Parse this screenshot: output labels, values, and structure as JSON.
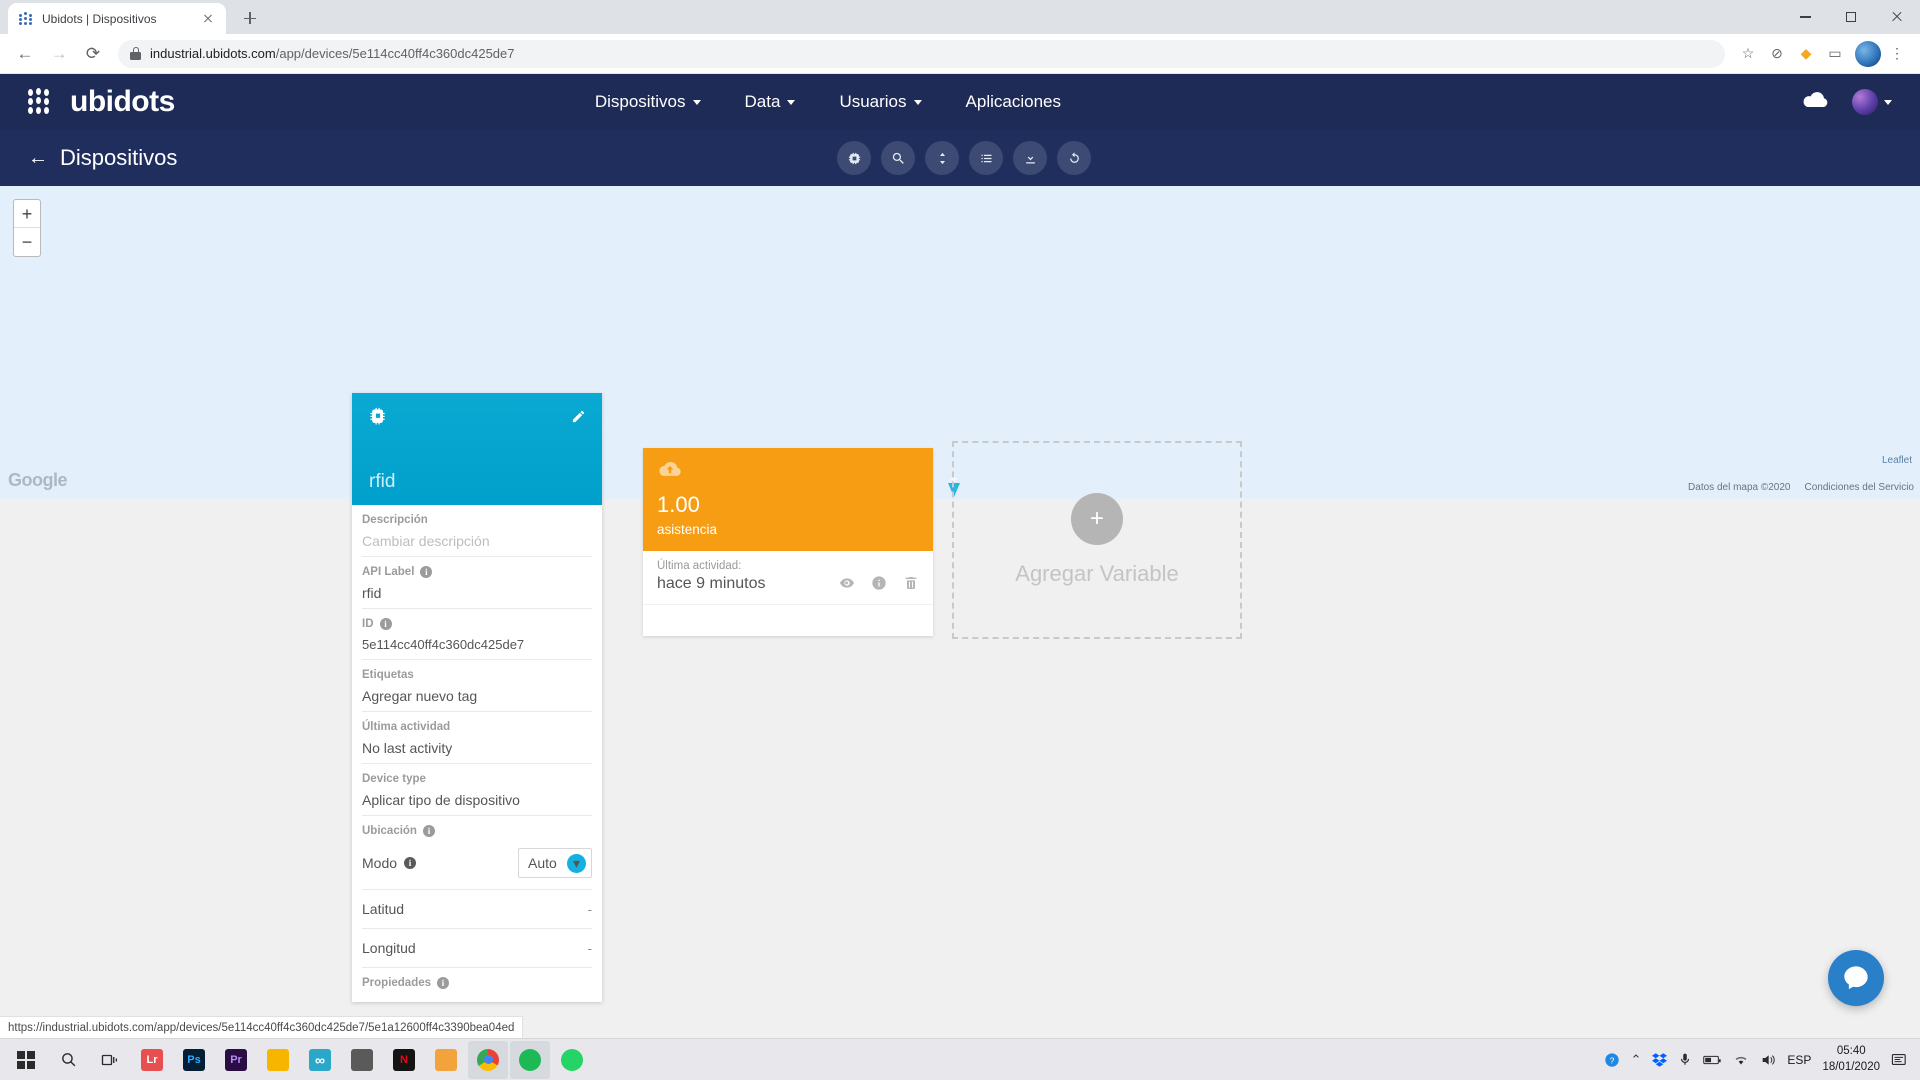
{
  "browser": {
    "tab": {
      "title": "Ubidots | Dispositivos",
      "favicon_icon": "ubidots-dots-icon",
      "close_icon": "close-icon"
    },
    "new_tab_icon": "plus-icon",
    "window_controls": {
      "minimize": "minimize-icon",
      "maximize": "maximize-icon",
      "close": "close-icon"
    },
    "nav": {
      "back_icon": "arrow-left-icon",
      "forward_icon": "arrow-right-icon",
      "reload_icon": "reload-icon"
    },
    "url": {
      "host": "industrial.ubidots.com",
      "path": "/app/devices/5e114cc40ff4c360dc425de7",
      "lock_icon": "lock-icon"
    },
    "omni_icons": [
      "star-icon",
      "block-icon",
      "extension-puzzle-icon",
      "cast-icon",
      "profile-avatar",
      "menu-kebab-icon"
    ],
    "status_link": "https://industrial.ubidots.com/app/devices/5e114cc40ff4c360dc425de7/5e1a12600ff4c3390bea04ed"
  },
  "topnav": {
    "logo_text": "ubidots",
    "logo_icon": "ubidots-dots-icon",
    "items": [
      {
        "label": "Dispositivos",
        "has_caret": true
      },
      {
        "label": "Data",
        "has_caret": true
      },
      {
        "label": "Usuarios",
        "has_caret": true
      },
      {
        "label": "Aplicaciones",
        "has_caret": false
      }
    ],
    "cloud_icon": "cloud-icon",
    "user_menu_icon": "user-avatar"
  },
  "subnav": {
    "back_label": "Dispositivos",
    "back_icon": "arrow-left-icon",
    "toolbar": [
      {
        "name": "device-chip-icon"
      },
      {
        "name": "search-icon"
      },
      {
        "name": "sort-icon"
      },
      {
        "name": "list-icon"
      },
      {
        "name": "download-icon"
      },
      {
        "name": "refresh-icon"
      }
    ]
  },
  "map": {
    "zoom_in": "+",
    "zoom_out": "−",
    "watermark": "Google",
    "pin_icon": "map-pin-plus-icon",
    "leaflet": "Leaflet",
    "attribution": [
      "Datos del mapa ©2020",
      "Condiciones del Servicio"
    ]
  },
  "device": {
    "name": "rfid",
    "header_icon": "chip-icon",
    "edit_icon": "pencil-icon",
    "fields": [
      {
        "label": "Descripción",
        "value": "Cambiar descripción",
        "placeholder": true,
        "info": false
      },
      {
        "label": "API Label",
        "value": "rfid",
        "placeholder": false,
        "info": true
      },
      {
        "label": "ID",
        "value": "5e114cc40ff4c360dc425de7",
        "placeholder": false,
        "info": true
      },
      {
        "label": "Etiquetas",
        "value": "Agregar nuevo tag",
        "placeholder": false,
        "info": false
      },
      {
        "label": "Última actividad",
        "value": "No last activity",
        "placeholder": false,
        "info": false
      },
      {
        "label": "Device type",
        "value": "Aplicar tipo de dispositivo",
        "placeholder": false,
        "info": false
      }
    ],
    "location": {
      "label": "Ubicación",
      "mode_label": "Modo",
      "mode_value": "Auto",
      "latitude_label": "Latitud",
      "latitude_value": "-",
      "longitude_label": "Longitud",
      "longitude_value": "-"
    },
    "properties_label": "Propiedades"
  },
  "variable_card": {
    "cloud_icon": "cloud-upload-icon",
    "value": "1.00",
    "unit": "asistencia",
    "activity_label": "Última actividad:",
    "activity_value": "hace 9 minutos",
    "icons": [
      {
        "name": "eye-icon"
      },
      {
        "name": "info-icon"
      },
      {
        "name": "trash-icon"
      }
    ],
    "color": "#f79d14"
  },
  "add_variable": {
    "label": "Agregar Variable",
    "plus_icon": "plus-icon"
  },
  "intercom": {
    "icon": "chat-bubble-icon",
    "color": "#2a7fc9"
  },
  "taskbar": {
    "start_icon": "windows-start-icon",
    "search_icon": "search-icon",
    "taskview_icon": "task-view-icon",
    "apps": [
      {
        "name": "lightroom-icon",
        "label": "Lr",
        "color": "#e8504f"
      },
      {
        "name": "photoshop-icon",
        "label": "Ps",
        "color": "#1b2c45"
      },
      {
        "name": "premiere-icon",
        "label": "Pr",
        "color": "#2c1b45"
      },
      {
        "name": "file-explorer-icon",
        "label": "",
        "color": "#f7b500"
      },
      {
        "name": "infinity-icon",
        "label": "∞",
        "color": "#2aa7c9"
      },
      {
        "name": "calculator-icon",
        "label": "",
        "color": "#4a4a4a"
      },
      {
        "name": "netflix-icon",
        "label": "N",
        "color": "#c9111a"
      },
      {
        "name": "mail-icon",
        "label": "",
        "color": "#f2a33c"
      },
      {
        "name": "chrome-icon",
        "label": "",
        "color": "#4285f4"
      },
      {
        "name": "spotify-icon",
        "label": "",
        "color": "#1db954"
      },
      {
        "name": "whatsapp-icon",
        "label": "",
        "color": "#25d366"
      }
    ],
    "tray": {
      "help_icon": "help-icon",
      "chevron_up_icon": "chevron-up-icon",
      "dropbox_icon": "dropbox-icon",
      "mic_icon": "microphone-icon",
      "battery_icon": "battery-icon",
      "wifi_icon": "wifi-icon",
      "volume_icon": "volume-icon",
      "language": "ESP",
      "time": "05:40",
      "date": "18/01/2020",
      "notifications_icon": "notifications-icon"
    }
  }
}
